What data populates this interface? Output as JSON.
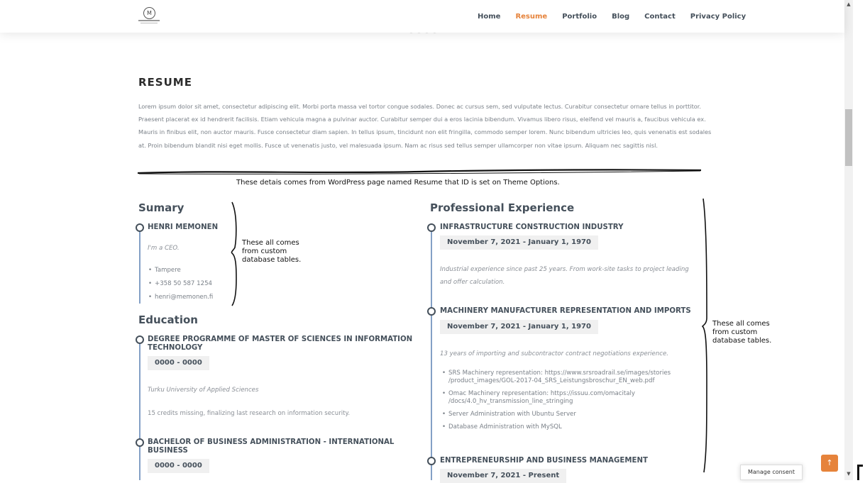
{
  "header": {
    "nav": [
      {
        "label": "Home",
        "active": false
      },
      {
        "label": "Resume",
        "active": true
      },
      {
        "label": "Portfolio",
        "active": false
      },
      {
        "label": "Blog",
        "active": false
      },
      {
        "label": "Contact",
        "active": false
      },
      {
        "label": "Privacy Policy",
        "active": false
      }
    ],
    "logo_glyph": "M"
  },
  "resume": {
    "title": "RESUME",
    "intro": "Lorem ipsum dolor sit amet, consectetur adipiscing elit. Morbi porta massa vel tortor congue sodales. Donec ac cursus sem, sed vulputate lectus. Curabitur consectetur ornare tellus in porttitor. Praesent placerat ex id hendrerit facilisis. Etiam vehicula magna a pulvinar auctor. Curabitur semper dui a eros lacinia bibendum. Vivamus libero risus, eleifend vel mauris a, faucibus vehicula ex. Mauris in finibus elit, non auctor mauris. Fusce consectetur diam sapien. In tellus ipsum, tincidunt non elit fringilla, commodo semper lorem. Nunc bibendum ultricies leo, quis venenatis est sodales at. Proin bibendum blandit nisi eget mollis. Fusce ut venenatis justo, vel malesuada ipsum. Nam ac risus sed tellus semper ullamcorper non vitae ipsum. Aliquam nec sagittis nisl.",
    "annotation_caption": "These detais comes from WordPress page named Resume that ID is set on Theme Options."
  },
  "summary": {
    "heading": "Sumary",
    "name": "HENRI MEMONEN",
    "role": "I'm a CEO.",
    "details": [
      "Tampere",
      "+358 50 587 1254",
      "henri@memonen.fi"
    ],
    "note": [
      "These all comes",
      "from custom",
      "database tables."
    ]
  },
  "education": {
    "heading": "Education",
    "items": [
      {
        "title": "DEGREE PROGRAMME OF MASTER OF SCIENCES IN INFORMATION TECHNOLOGY",
        "dates": "0000 - 0000",
        "school": "Turku University of Applied Sciences",
        "desc": "15 credits missing, finalizing last research on information security."
      },
      {
        "title": "BACHELOR OF BUSINESS ADMINISTRATION - INTERNATIONAL BUSINESS",
        "dates": "0000 - 0000"
      }
    ]
  },
  "experience": {
    "heading": "Professional Experience",
    "items": [
      {
        "title": "INFRASTRUCTURE CONSTRUCTION INDUSTRY",
        "dates": "November 7, 2021 - January 1, 1970",
        "desc": "Industrial experience since past 25 years. From work-site tasks to project leading and offer calculation."
      },
      {
        "title": "MACHINERY MANUFACTURER REPRESENTATION AND IMPORTS",
        "dates": "November 7, 2021 - January 1, 1970",
        "desc": "13 years of importing and subcontractor contract negotiations experience.",
        "bullets": [
          "SRS Machinery representation: https://www.srsroadrail.se/images/stories /product_images/GOL-2017-04_SRS_Leistungsbroschur_EN_web.pdf",
          "Omac Machinery representation: https://issuu.com/omacitaly /docs/4.0_hv_transmission_line_stringing",
          "Server Administration with Ubuntu Server",
          "Database Administration with MySQL"
        ]
      },
      {
        "title": "ENTREPRENEURSHIP AND BUSINESS MANAGEMENT",
        "dates": "November 7, 2021 - Present"
      }
    ],
    "note": [
      "These all comes",
      "from custom",
      "database tables."
    ]
  },
  "footer": {
    "manage_consent": "Manage consent",
    "back_to_top_icon": "arrow-up-icon"
  }
}
